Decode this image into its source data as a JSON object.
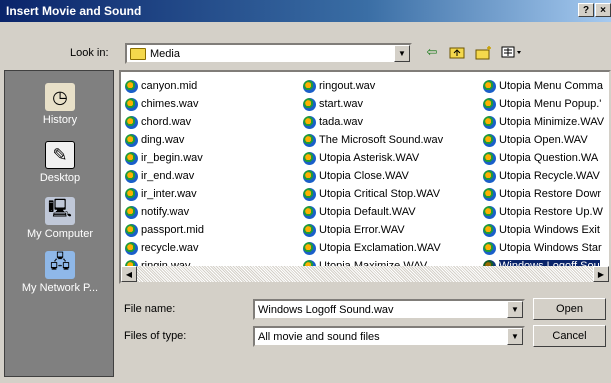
{
  "window": {
    "title": "Insert Movie and Sound",
    "help_label": "?",
    "close_label": "×"
  },
  "toolbar": {
    "look_in_label": "Look in:",
    "look_in_value": "Media"
  },
  "places": [
    {
      "label": "History",
      "icon": "history-icon"
    },
    {
      "label": "Desktop",
      "icon": "desktop-icon"
    },
    {
      "label": "My Computer",
      "icon": "computer-icon"
    },
    {
      "label": "My Network P...",
      "icon": "network-icon"
    }
  ],
  "files": {
    "col1": [
      "canyon.mid",
      "chimes.wav",
      "chord.wav",
      "ding.wav",
      "ir_begin.wav",
      "ir_end.wav",
      "ir_inter.wav",
      "notify.wav",
      "passport.mid",
      "recycle.wav",
      "ringin.wav"
    ],
    "col2": [
      "ringout.wav",
      "start.wav",
      "tada.wav",
      "The Microsoft Sound.wav",
      "Utopia Asterisk.WAV",
      "Utopia Close.WAV",
      "Utopia Critical Stop.WAV",
      "Utopia Default.WAV",
      "Utopia Error.WAV",
      "Utopia Exclamation.WAV",
      "Utopia Maximize.WAV"
    ],
    "col3": [
      "Utopia Menu Comma",
      "Utopia Menu Popup.'",
      "Utopia Minimize.WAV",
      "Utopia Open.WAV",
      "Utopia Question.WA",
      "Utopia Recycle.WAV",
      "Utopia Restore Dowr",
      "Utopia Restore Up.W",
      "Utopia Windows Exit",
      "Utopia Windows Star",
      "Windows Logoff Sou"
    ]
  },
  "selected_file": "Windows Logoff Sou",
  "form": {
    "filename_label": "File name:",
    "filename_value": "Windows Logoff Sound.wav",
    "filetype_label": "Files of type:",
    "filetype_value": "All movie and sound files",
    "open_label": "Open",
    "cancel_label": "Cancel"
  }
}
